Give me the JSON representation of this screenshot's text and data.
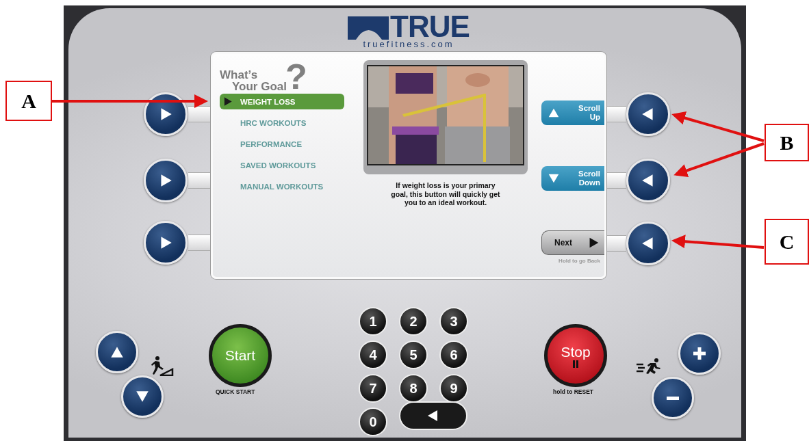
{
  "logo": {
    "brand": "TRUE",
    "url": "truefitness.com"
  },
  "screen": {
    "title_line_1": "What’s",
    "title_line_2": "Your Goal",
    "title_mark": "?",
    "menu": [
      {
        "label": "WEIGHT LOSS",
        "selected": true
      },
      {
        "label": "HRC WORKOUTS",
        "selected": false
      },
      {
        "label": "PERFORMANCE",
        "selected": false
      },
      {
        "label": "SAVED WORKOUTS",
        "selected": false
      },
      {
        "label": "MANUAL WORKOUTS",
        "selected": false
      }
    ],
    "description": "If weight loss is your primary goal, this button will quickly get you to an ideal workout.",
    "buttons": [
      {
        "kind": "up",
        "label_line_1": "Scroll",
        "label_line_2": "Up"
      },
      {
        "kind": "down",
        "label_line_1": "Scroll",
        "label_line_2": "Down"
      },
      {
        "kind": "next",
        "label": "Next",
        "hint": "Hold to go Back"
      }
    ]
  },
  "start": {
    "label": "Start",
    "caption": "QUICK START"
  },
  "keypad": [
    "1",
    "2",
    "3",
    "4",
    "5",
    "6",
    "7",
    "8",
    "9",
    "0"
  ],
  "stop": {
    "label": "Stop",
    "caption": "hold to RESET"
  },
  "annotations": [
    {
      "label": "A"
    },
    {
      "label": "B"
    },
    {
      "label": "C"
    }
  ]
}
